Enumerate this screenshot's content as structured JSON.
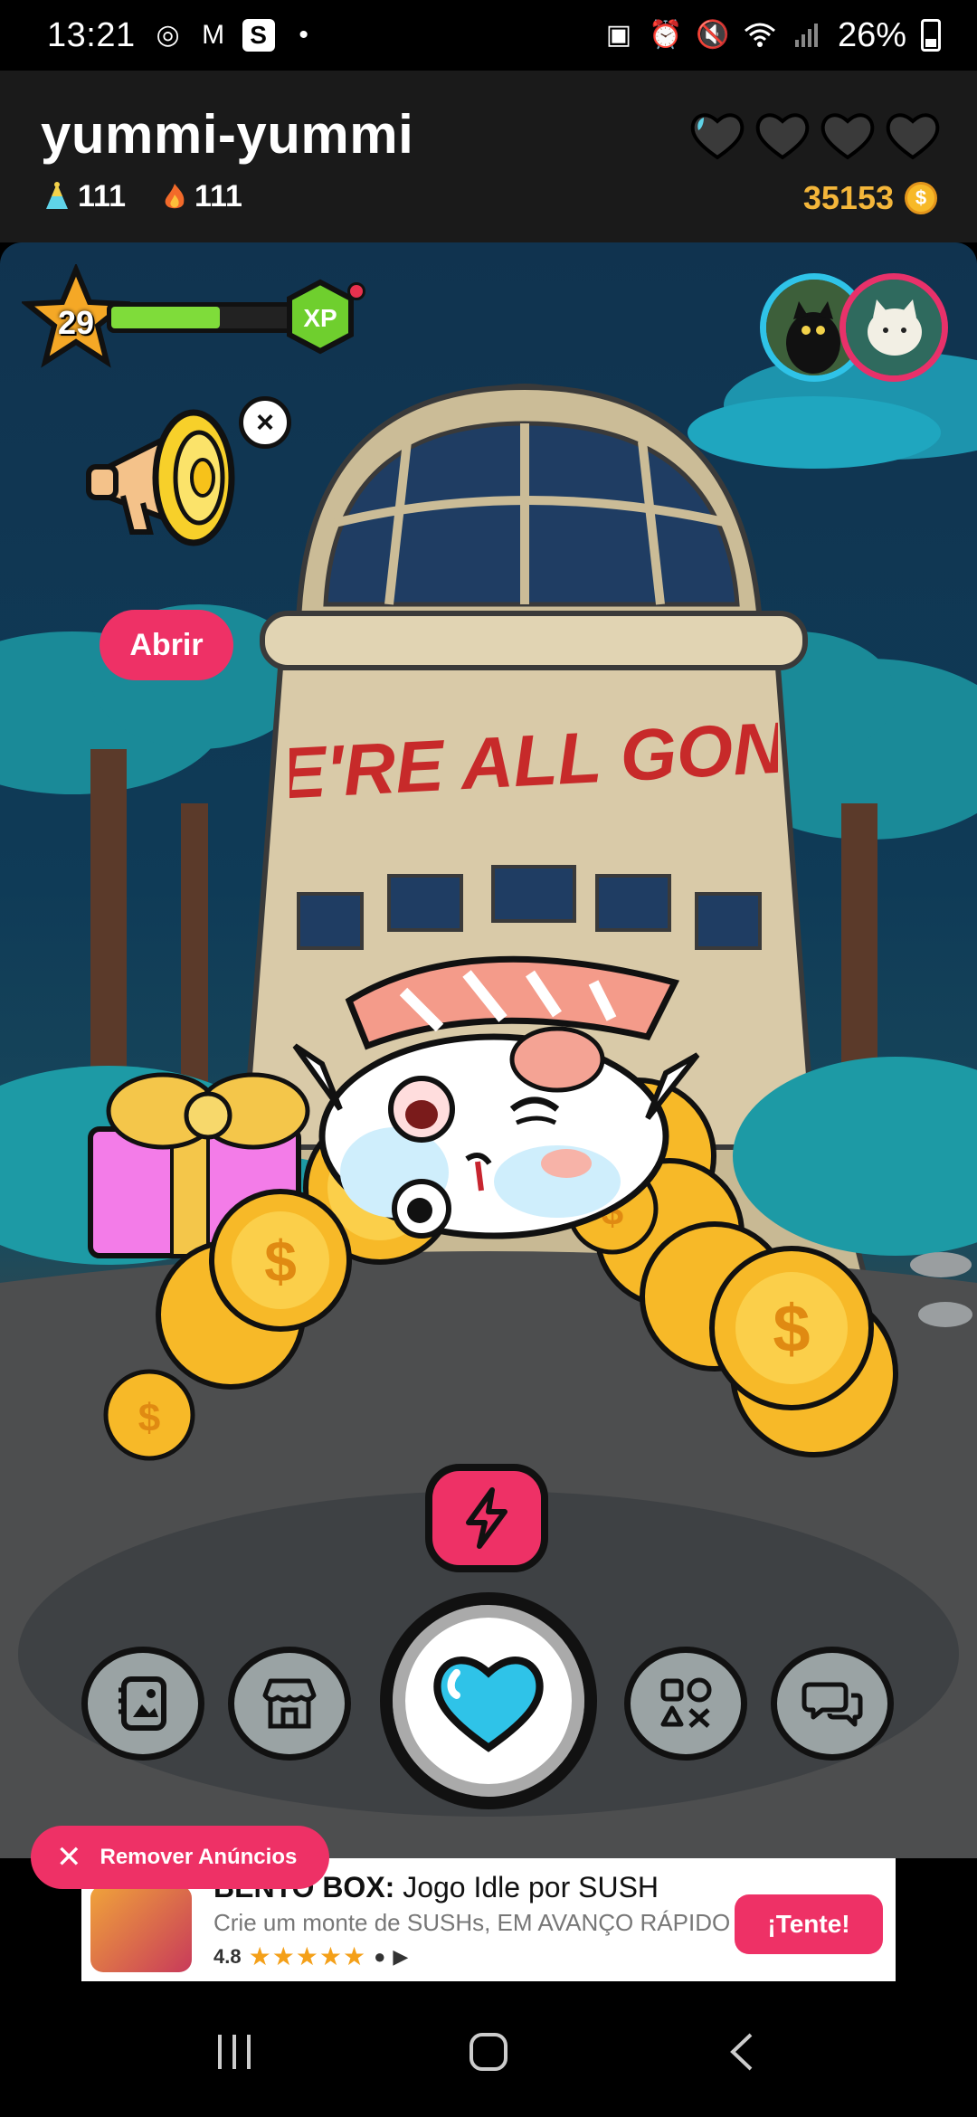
{
  "status_bar": {
    "time": "13:21",
    "battery": "26%",
    "notification_icons": [
      "target-icon",
      "gmail-icon",
      "s-app-icon",
      "dot-icon"
    ],
    "system_icons": [
      "sim-icon",
      "alarm-icon",
      "mute-icon",
      "wifi-icon",
      "signal-icon",
      "battery-icon"
    ]
  },
  "header": {
    "username": "yummi-yummi",
    "stats": [
      {
        "icon": "party-hat-icon",
        "value": "111"
      },
      {
        "icon": "flame-icon",
        "value": "111"
      }
    ],
    "hearts_total": 4,
    "hearts_partial_first": true,
    "coins": "35153"
  },
  "game": {
    "level": "29",
    "xp_badge": "XP",
    "xp_progress": 0.6,
    "open_button": "Abrir",
    "close_symbol": "×",
    "building_sign": "WE'RE ALL GONE!",
    "friend_avatars": [
      "black-cat-avatar",
      "white-cat-avatar"
    ]
  },
  "bottom_nav": {
    "buttons": [
      "album-icon",
      "shop-icon",
      "heart-icon",
      "games-icon",
      "chat-icon"
    ]
  },
  "remove_ads": {
    "label": "Remover Anúncios"
  },
  "ad": {
    "title_bold": "BENTO BOX:",
    "title_rest": " Jogo Idle por SUSH",
    "subtitle": "Crie um monte de SUSHs, EM AVANÇO RÁPIDO",
    "rating": "4.8",
    "stars": "★★★★★",
    "cta": "¡Tente!"
  },
  "system_nav": [
    "recents-button",
    "home-button",
    "back-button"
  ],
  "colors": {
    "accent": "#ee3166",
    "coin": "#f4b63a",
    "xp_green": "#7fdc3a",
    "heart_blue": "#2fc3e8"
  }
}
